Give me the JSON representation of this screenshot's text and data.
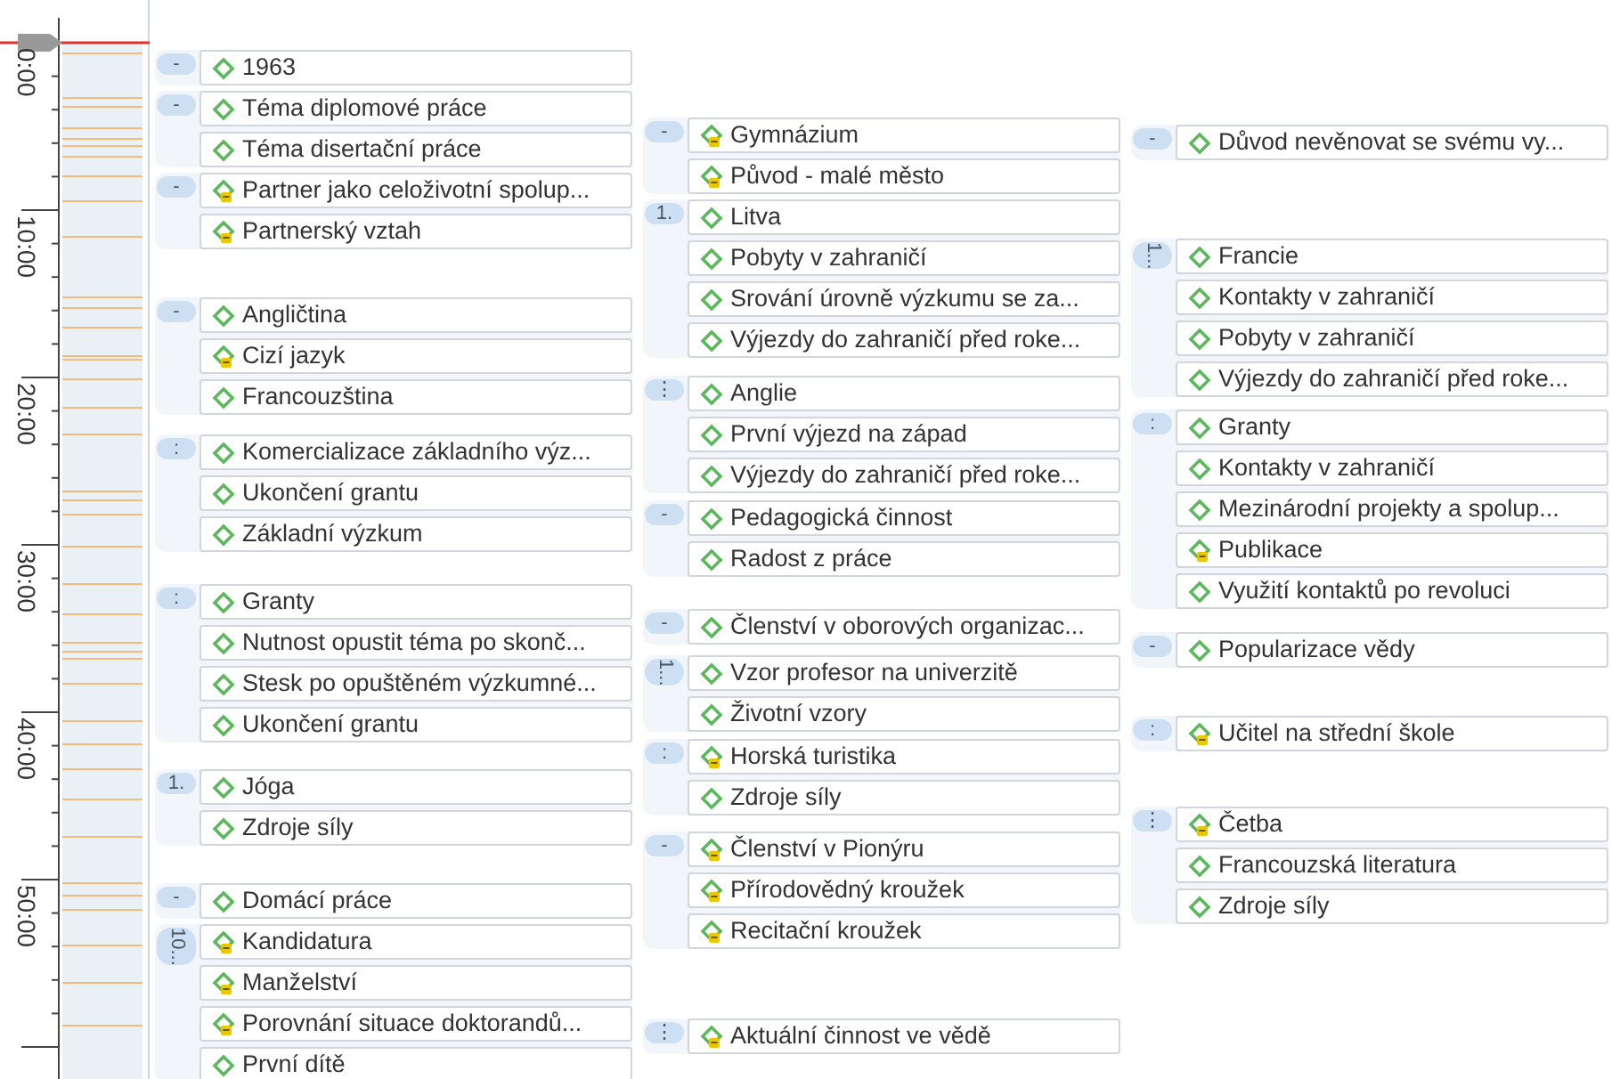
{
  "timeline": {
    "labels": [
      "0:00",
      "10:00",
      "20:00",
      "30:00",
      "40:00",
      "50:00"
    ]
  },
  "columns": [
    {
      "groups": [
        {
          "badge": "-",
          "items": [
            {
              "text": "1963",
              "kind": "code"
            }
          ]
        },
        {
          "badge": "-",
          "items": [
            {
              "text": "Téma diplomové práce",
              "kind": "code"
            },
            {
              "text": "Téma disertační práce",
              "kind": "code"
            }
          ]
        },
        {
          "badge": "-",
          "items": [
            {
              "text": "Partner jako celoživotní spolup...",
              "kind": "memo"
            },
            {
              "text": "Partnerský vztah",
              "kind": "memo"
            }
          ]
        },
        {
          "badge": "-",
          "items": [
            {
              "text": "Angličtina",
              "kind": "code"
            },
            {
              "text": "Cizí jazyk",
              "kind": "memo"
            },
            {
              "text": "Francouzština",
              "kind": "code"
            }
          ]
        },
        {
          "badge": ":",
          "items": [
            {
              "text": "Komercializace základního výz...",
              "kind": "code"
            },
            {
              "text": "Ukončení grantu",
              "kind": "code"
            },
            {
              "text": "Základní výzkum",
              "kind": "code"
            }
          ]
        },
        {
          "badge": ":",
          "items": [
            {
              "text": "Granty",
              "kind": "code"
            },
            {
              "text": "Nutnost opustit téma po skonč...",
              "kind": "code"
            },
            {
              "text": "Stesk po opuštěném výzkumné...",
              "kind": "code"
            },
            {
              "text": "Ukončení grantu",
              "kind": "code"
            }
          ]
        },
        {
          "badge": "1.",
          "items": [
            {
              "text": "Jóga",
              "kind": "code"
            },
            {
              "text": "Zdroje síly",
              "kind": "code"
            }
          ]
        },
        {
          "badge": "-",
          "items": [
            {
              "text": "Domácí práce",
              "kind": "code"
            }
          ]
        },
        {
          "badge": "10...",
          "items": [
            {
              "text": "Kandidatura",
              "kind": "memo"
            },
            {
              "text": "Manželství",
              "kind": "memo"
            },
            {
              "text": "Porovnání situace doktorandů...",
              "kind": "memo"
            },
            {
              "text": "První dítě",
              "kind": "code"
            }
          ]
        }
      ]
    },
    {
      "groups": [
        {
          "badge": "-",
          "items": [
            {
              "text": "Gymnázium",
              "kind": "memo"
            },
            {
              "text": "Původ - malé město",
              "kind": "memo"
            }
          ]
        },
        {
          "badge": "1.",
          "items": [
            {
              "text": "Litva",
              "kind": "code"
            },
            {
              "text": "Pobyty v zahraničí",
              "kind": "code"
            },
            {
              "text": "Srování úrovně výzkumu se za...",
              "kind": "code"
            },
            {
              "text": "Výjezdy do zahraničí před roke...",
              "kind": "code"
            }
          ]
        },
        {
          "badge": "⋮",
          "items": [
            {
              "text": "Anglie",
              "kind": "code"
            },
            {
              "text": "První výjezd na západ",
              "kind": "code"
            },
            {
              "text": "Výjezdy do zahraničí před roke...",
              "kind": "code"
            }
          ]
        },
        {
          "badge": "-",
          "items": [
            {
              "text": "Pedagogická činnost",
              "kind": "code"
            },
            {
              "text": "Radost z práce",
              "kind": "code"
            }
          ]
        },
        {
          "badge": "-",
          "items": [
            {
              "text": "Členství v oborových organizac...",
              "kind": "code"
            }
          ]
        },
        {
          "badge": "1...",
          "items": [
            {
              "text": "Vzor profesor na univerzitě",
              "kind": "code"
            },
            {
              "text": "Životní vzory",
              "kind": "code"
            }
          ]
        },
        {
          "badge": ":",
          "items": [
            {
              "text": "Horská turistika",
              "kind": "memo"
            },
            {
              "text": "Zdroje síly",
              "kind": "code"
            }
          ]
        },
        {
          "badge": "-",
          "items": [
            {
              "text": "Členství v Pionýru",
              "kind": "memo"
            },
            {
              "text": "Přírodovědný kroužek",
              "kind": "memo"
            },
            {
              "text": "Recitační kroužek",
              "kind": "memo"
            }
          ]
        },
        {
          "badge": "⋮",
          "items": [
            {
              "text": "Aktuální činnost ve vědě",
              "kind": "memo"
            }
          ]
        }
      ]
    },
    {
      "groups": [
        {
          "badge": "-",
          "items": [
            {
              "text": "Důvod nevěnovat se svému vy...",
              "kind": "code"
            }
          ]
        },
        {
          "badge": "1...",
          "items": [
            {
              "text": "Francie",
              "kind": "code"
            },
            {
              "text": "Kontakty v zahraničí",
              "kind": "code"
            },
            {
              "text": "Pobyty v zahraničí",
              "kind": "code"
            },
            {
              "text": "Výjezdy do zahraničí před roke...",
              "kind": "code"
            }
          ]
        },
        {
          "badge": ":",
          "items": [
            {
              "text": "Granty",
              "kind": "code"
            },
            {
              "text": "Kontakty v zahraničí",
              "kind": "code"
            },
            {
              "text": "Mezinárodní projekty a spolup...",
              "kind": "code"
            },
            {
              "text": "Publikace",
              "kind": "memo"
            },
            {
              "text": "Využití kontaktů po revoluci",
              "kind": "code"
            }
          ]
        },
        {
          "badge": "-",
          "items": [
            {
              "text": "Popularizace vědy",
              "kind": "code"
            }
          ]
        },
        {
          "badge": ":",
          "items": [
            {
              "text": "Učitel na střední škole",
              "kind": "memo"
            }
          ]
        },
        {
          "badge": "⋮",
          "items": [
            {
              "text": "Četba",
              "kind": "memo"
            },
            {
              "text": "Francouzská literatura",
              "kind": "code"
            },
            {
              "text": "Zdroje síly",
              "kind": "code"
            }
          ]
        }
      ]
    }
  ]
}
